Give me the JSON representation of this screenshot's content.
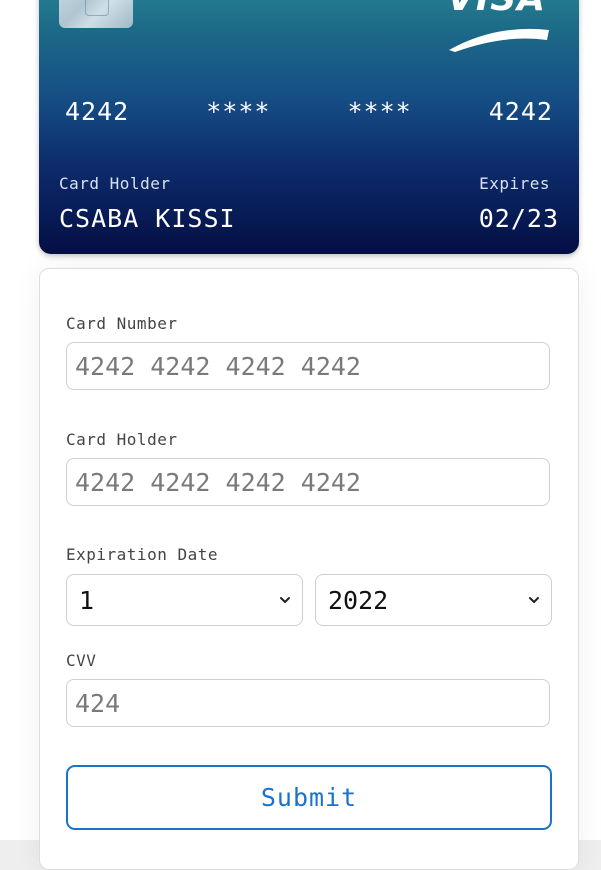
{
  "card": {
    "brand": "VISA",
    "number_groups": [
      "4242",
      "****",
      "****",
      "4242"
    ],
    "holder_label": "Card Holder",
    "holder_value": "CSABA KISSI",
    "expires_label": "Expires",
    "expires_value": "02/23"
  },
  "form": {
    "card_number": {
      "label": "Card Number",
      "placeholder": "4242 4242 4242 4242",
      "value": ""
    },
    "card_holder": {
      "label": "Card Holder",
      "placeholder": "4242 4242 4242 4242",
      "value": ""
    },
    "expiration": {
      "label": "Expiration Date",
      "month_selected": "1",
      "year_selected": "2022",
      "chevron_icon": "chevron-down-icon"
    },
    "cvv": {
      "label": "CVV",
      "placeholder": "424",
      "value": ""
    },
    "submit_label": "Submit"
  },
  "colors": {
    "accent": "#1a73c9",
    "card_gradient_top": "#2a8a94",
    "card_gradient_bottom": "#040f44"
  }
}
